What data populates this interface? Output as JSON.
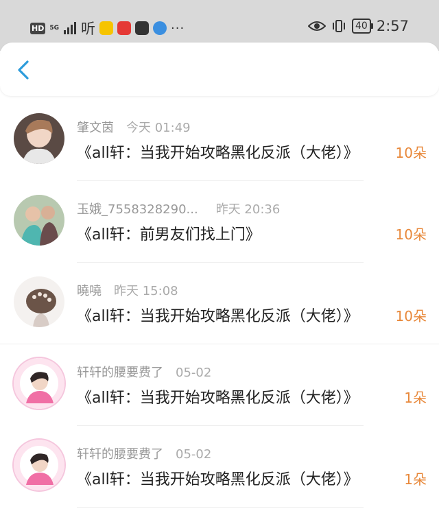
{
  "statusbar": {
    "network": "HD",
    "signal": "5G",
    "listen_icon_text": "听",
    "time": "2:57",
    "battery": "40",
    "more": "···"
  },
  "header": {
    "back_icon": "chevron-left-icon"
  },
  "items": [
    {
      "name": "肇文茵",
      "time": "今天 01:49",
      "title": "《all轩：当我开始攻略黑化反派（大佬）》",
      "count": "10朵"
    },
    {
      "name": "玉娥_7558328290...",
      "time": "昨天 20:36",
      "title": "《all轩：前男友们找上门》",
      "count": "10朵"
    },
    {
      "name": "曉嘵",
      "time": "昨天 15:08",
      "title": "《all轩：当我开始攻略黑化反派（大佬）》",
      "count": "10朵"
    },
    {
      "name": "轩轩的腰要费了",
      "time": "05-02",
      "title": "《all轩：当我开始攻略黑化反派（大佬）》",
      "count": "1朵"
    },
    {
      "name": "轩轩的腰要费了",
      "time": "05-02",
      "title": "《all轩：当我开始攻略黑化反派（大佬）》",
      "count": "1朵"
    }
  ],
  "colors": {
    "accent": "#2d9cdb",
    "count": "#e8883a",
    "statusbar": "#d9d9d9"
  }
}
